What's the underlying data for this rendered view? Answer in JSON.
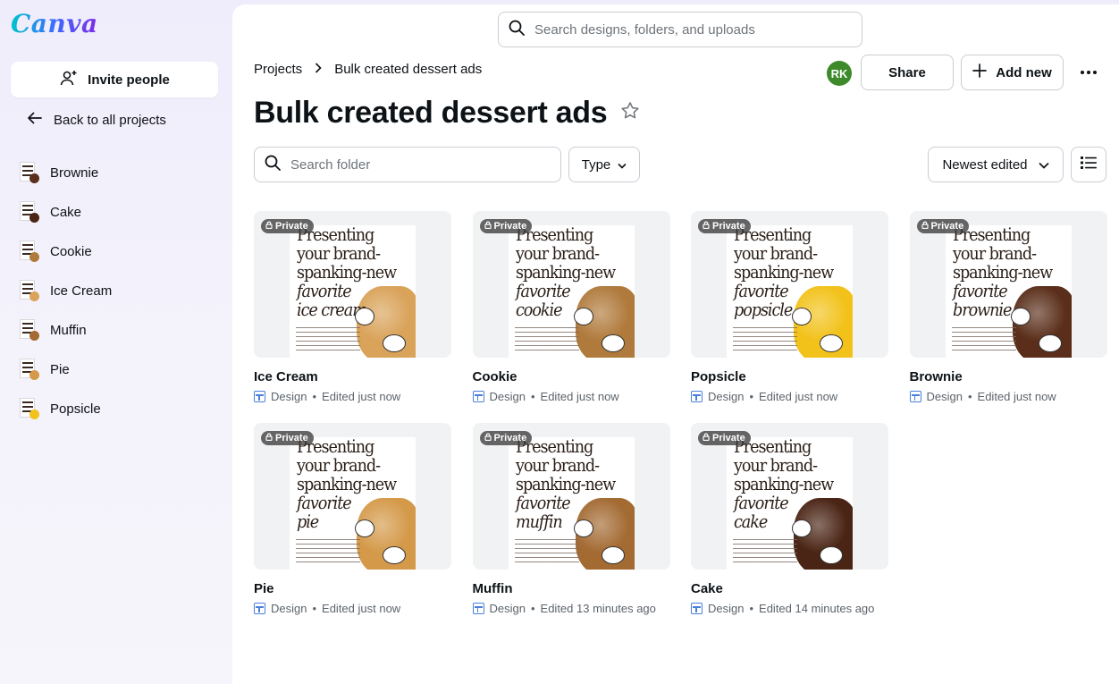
{
  "app": {
    "logo": "Canva"
  },
  "sidebar": {
    "invite_label": "Invite people",
    "back_label": "Back to all projects",
    "items": [
      {
        "label": "Brownie",
        "color": "#5a2e1a"
      },
      {
        "label": "Cake",
        "color": "#4a2414"
      },
      {
        "label": "Cookie",
        "color": "#b07a3c"
      },
      {
        "label": "Ice Cream",
        "color": "#d9a35a"
      },
      {
        "label": "Muffin",
        "color": "#a36a32"
      },
      {
        "label": "Pie",
        "color": "#d49a4a"
      },
      {
        "label": "Popsicle",
        "color": "#f2c21a"
      }
    ]
  },
  "header": {
    "search_placeholder": "Search designs, folders, and uploads",
    "breadcrumb": [
      "Projects",
      "Bulk created dessert ads"
    ],
    "title": "Bulk created dessert ads",
    "avatar_initials": "RK",
    "share_label": "Share",
    "add_new_label": "Add new"
  },
  "toolbar": {
    "folder_search_placeholder": "Search folder",
    "type_label": "Type",
    "sort_label": "Newest edited"
  },
  "poster_text": {
    "line1": "Presenting",
    "line2": "your brand-",
    "line3": "spanking-new",
    "line4": "favorite"
  },
  "designs": [
    {
      "name": "Ice Cream",
      "item": "ice cream",
      "badge": "Private",
      "kind": "Design",
      "edited": "Edited just now",
      "food_color": "#d9a35a"
    },
    {
      "name": "Cookie",
      "item": "cookie",
      "badge": "Private",
      "kind": "Design",
      "edited": "Edited just now",
      "food_color": "#b07a3c"
    },
    {
      "name": "Popsicle",
      "item": "popsicle",
      "badge": "Private",
      "kind": "Design",
      "edited": "Edited just now",
      "food_color": "#f2c21a"
    },
    {
      "name": "Brownie",
      "item": "brownie",
      "badge": "Private",
      "kind": "Design",
      "edited": "Edited just now",
      "food_color": "#5a2e1a"
    },
    {
      "name": "Pie",
      "item": "pie",
      "badge": "Private",
      "kind": "Design",
      "edited": "Edited just now",
      "food_color": "#d49a4a"
    },
    {
      "name": "Muffin",
      "item": "muffin",
      "badge": "Private",
      "kind": "Design",
      "edited": "Edited 13 minutes ago",
      "food_color": "#a36a32"
    },
    {
      "name": "Cake",
      "item": "cake",
      "badge": "Private",
      "kind": "Design",
      "edited": "Edited 14 minutes ago",
      "food_color": "#4a2414"
    }
  ]
}
